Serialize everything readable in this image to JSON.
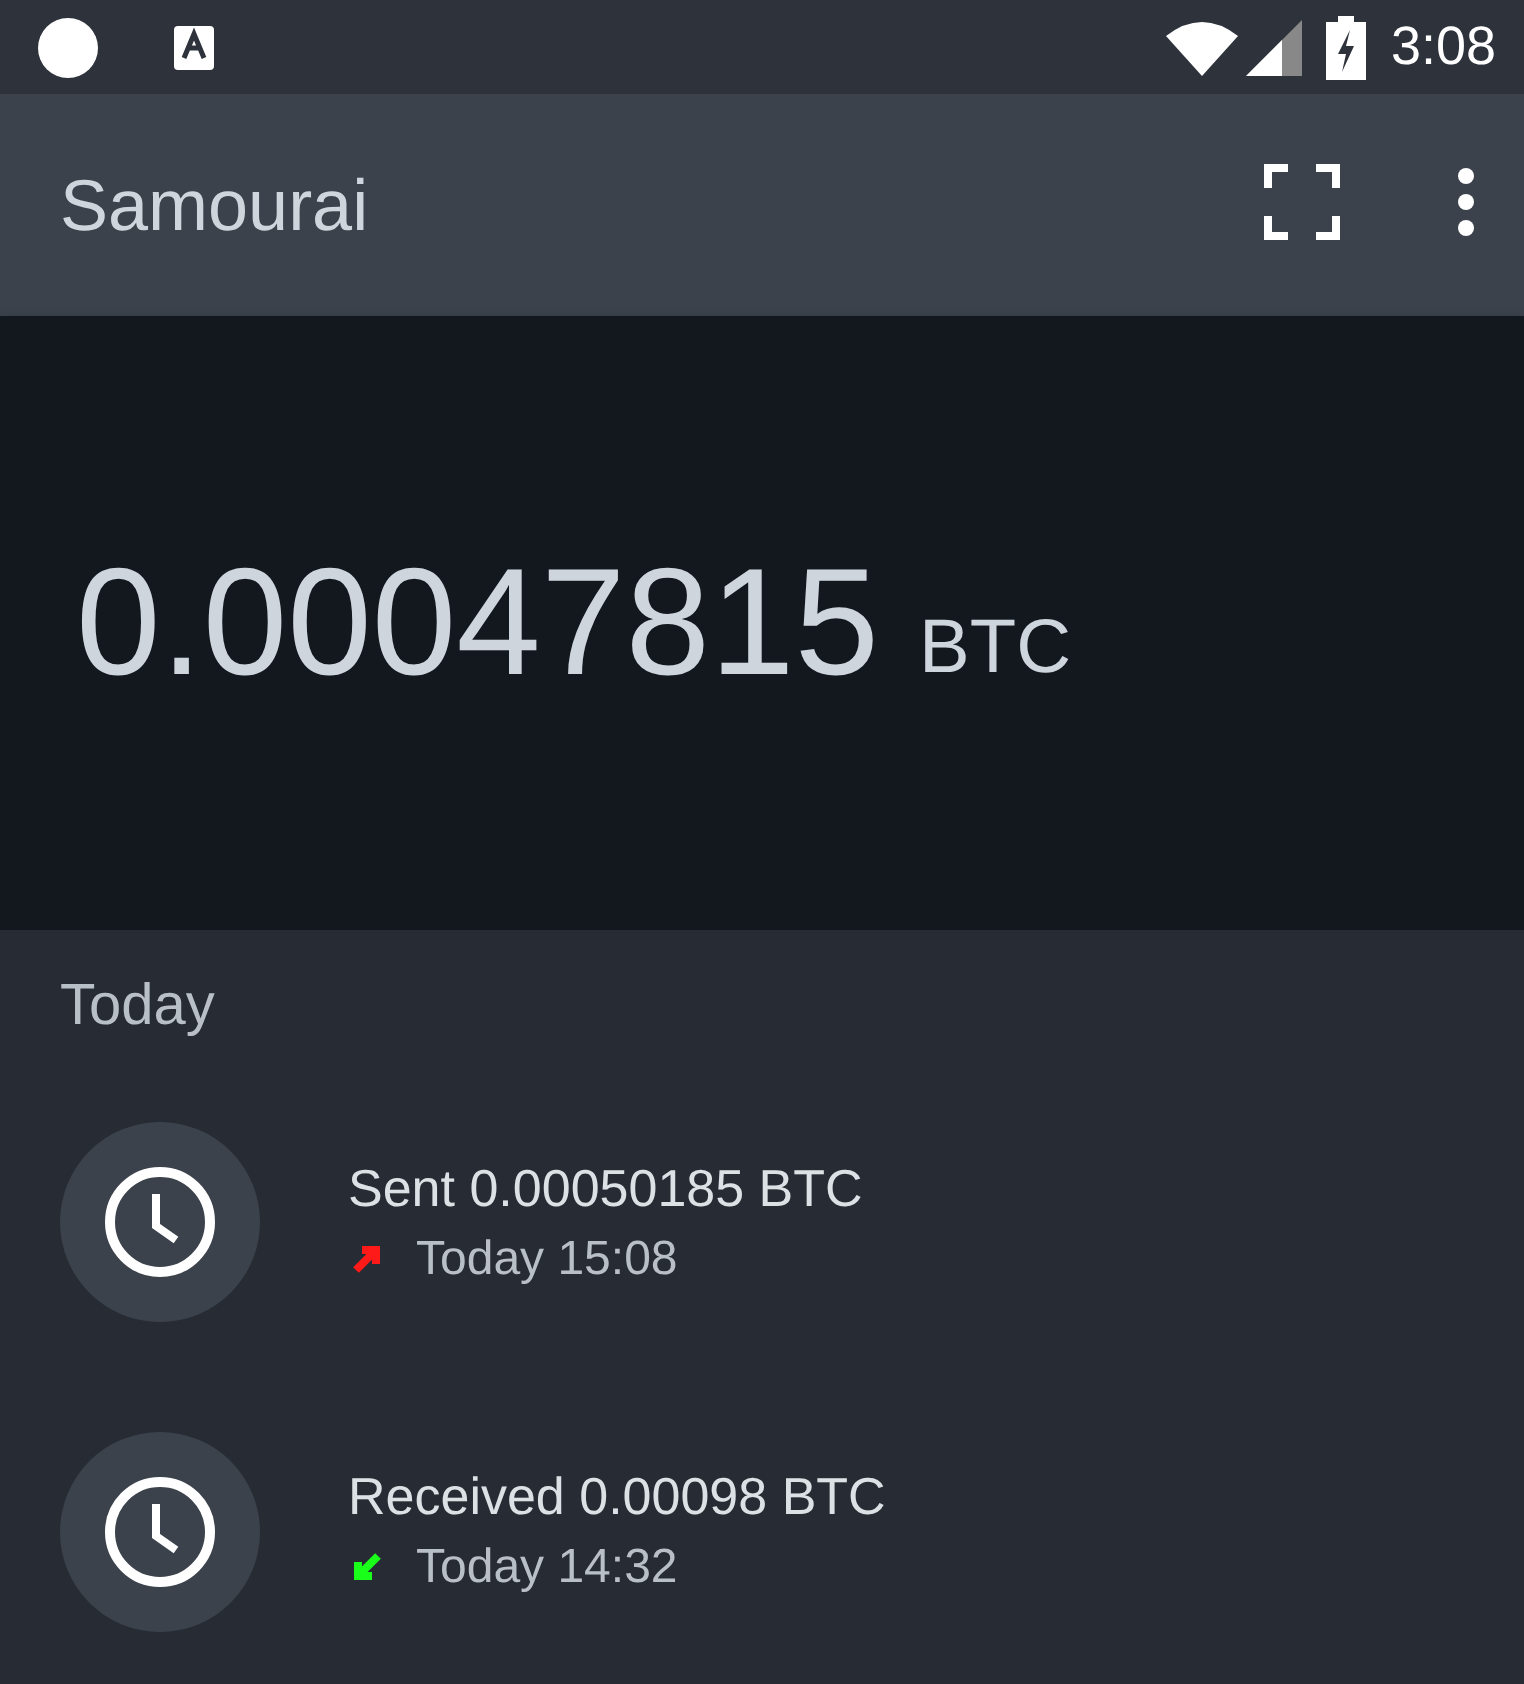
{
  "status_bar": {
    "time": "3:08"
  },
  "app_bar": {
    "title": "Samourai"
  },
  "balance": {
    "amount": "0.00047815",
    "unit": "BTC"
  },
  "section": {
    "title": "Today"
  },
  "transactions": [
    {
      "kind": "sent",
      "title": "Sent 0.00050185 BTC",
      "time": "Today 15:08"
    },
    {
      "kind": "received",
      "title": "Received 0.00098 BTC",
      "time": "Today 14:32"
    }
  ]
}
